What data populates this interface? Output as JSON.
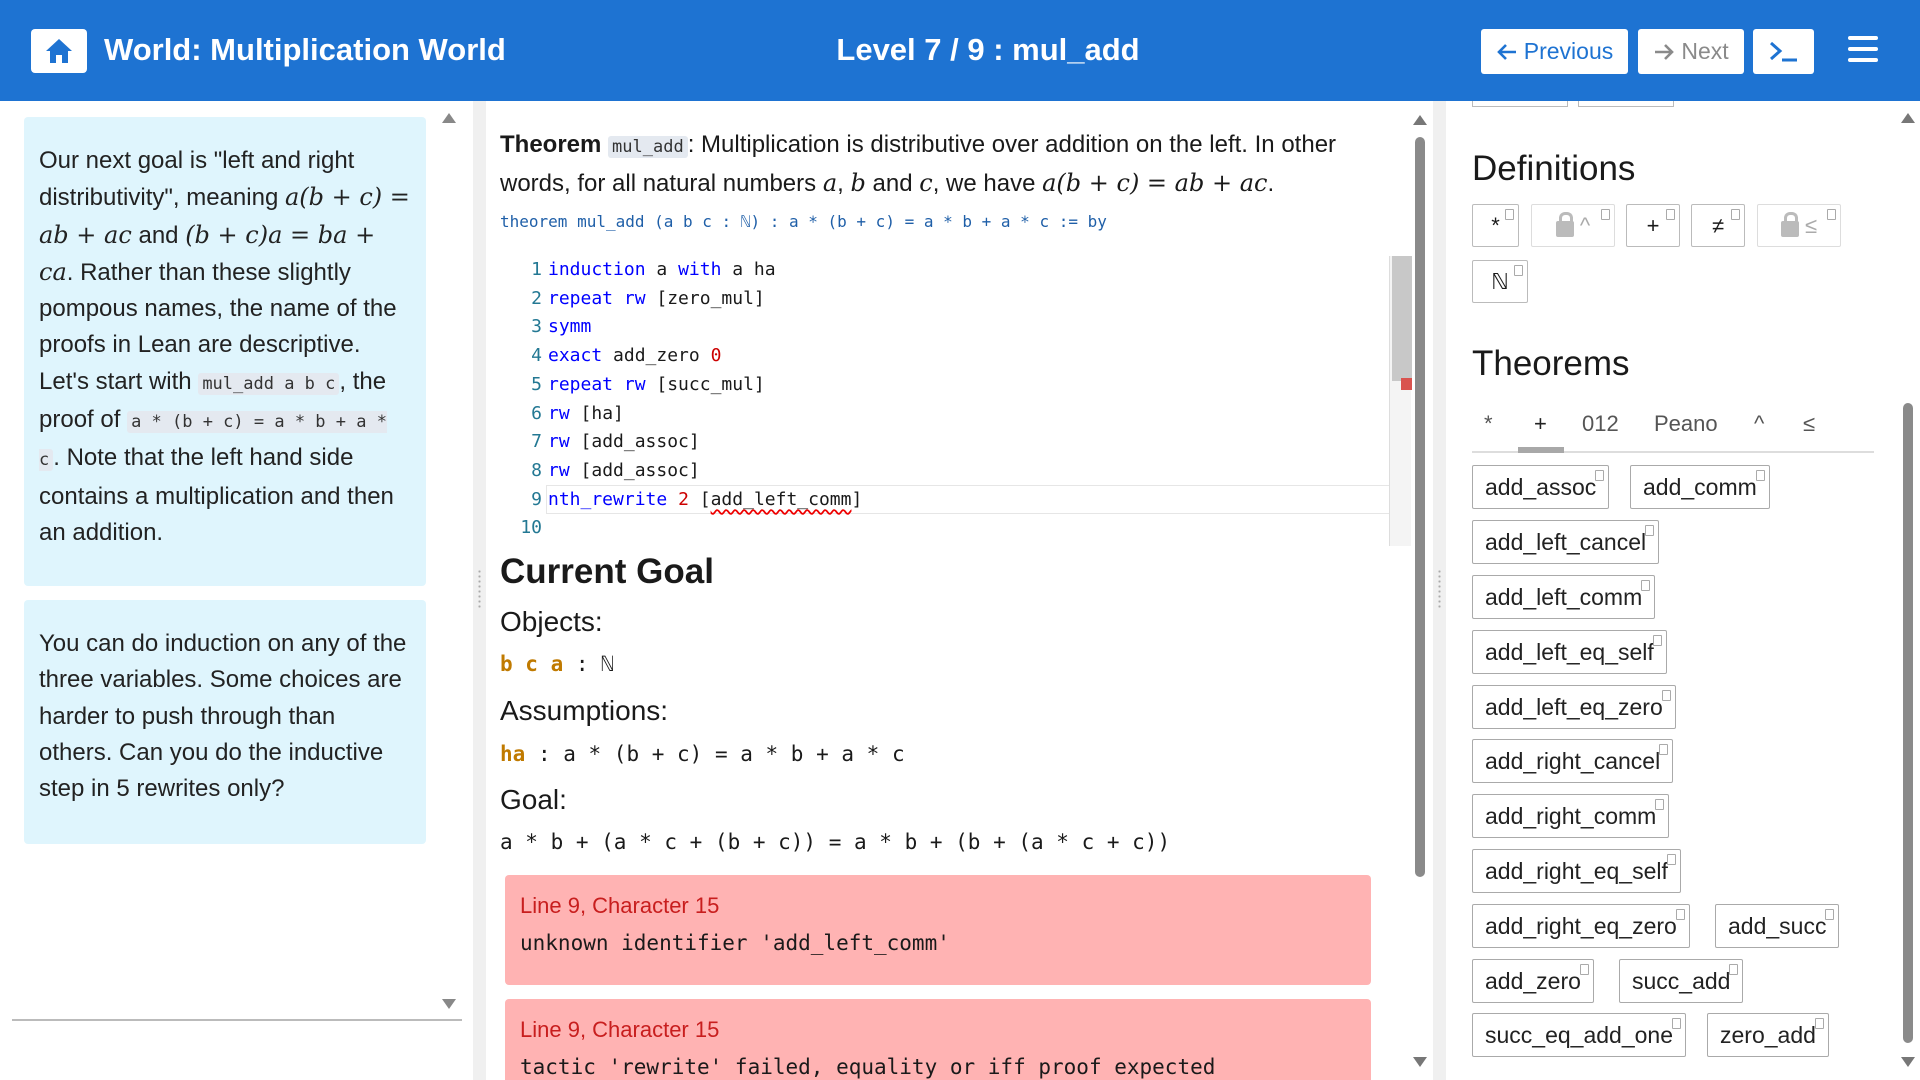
{
  "header": {
    "world_title": "World: Multiplication World",
    "level_title": "Level 7 / 9 : mul_add",
    "previous_label": "Previous",
    "next_label": "Next",
    "bg_color": "#1e73d2"
  },
  "left": {
    "card1": {
      "t1": "Our next goal is \"left and right distributivity\", meaning ",
      "m1": "a(b + c) = ab + ac",
      "t2": " and ",
      "m2": "(b + c)a = ba + ca",
      "t3": ". Rather than these slightly pompous names, the name of the proofs in Lean are descriptive. Let's start with ",
      "c1": "mul_add a b c",
      "t4": ", the proof of ",
      "c2": "a * (b + c) = a * b + a * c",
      "t5": ". Note that the left hand side contains a multiplication and then an addition."
    },
    "card2": "You can do induction on any of the three variables. Some choices are harder to push through than others. Can you do the inductive step in 5 rewrites only?"
  },
  "center": {
    "theorem": {
      "word": "Theorem",
      "name": "mul_add",
      "text1": ": Multiplication is distributive over addition on the left. In other words, for all natural numbers ",
      "ma": "a",
      "sep1": ", ",
      "mb": "b",
      "sep2": " and ",
      "mc": "c",
      "text2": ", we have ",
      "formula": "a(b + c) = ab + ac",
      "end": ".",
      "code": "theorem mul_add (a b c : ℕ) : a * (b + c) = a * b + a * c := by"
    },
    "editor": {
      "lines": [
        {
          "n": "1",
          "kw": "induction",
          "rest": " a ",
          "kw2": "with",
          "rest2": " a ha"
        },
        {
          "n": "2",
          "kw": "repeat rw",
          "rest": " [zero_mul]"
        },
        {
          "n": "3",
          "kw": "symm",
          "rest": ""
        },
        {
          "n": "4",
          "kw": "exact",
          "rest": " add_zero ",
          "num": "0"
        },
        {
          "n": "5",
          "kw": "repeat rw",
          "rest": " [succ_mul]"
        },
        {
          "n": "6",
          "kw": "rw",
          "rest": " [ha]"
        },
        {
          "n": "7",
          "kw": "rw",
          "rest": " [add_assoc]"
        },
        {
          "n": "8",
          "kw": "rw",
          "rest": " [add_assoc]"
        },
        {
          "n": "9",
          "kw": "nth_rewrite",
          "num": "2",
          "rest": " [",
          "err": "add_left_comm",
          "rest2": "]"
        },
        {
          "n": "10"
        }
      ]
    },
    "goal": {
      "heading": "Current Goal",
      "objects_label": "Objects:",
      "objects_names": "b c a",
      "objects_type": "ℕ",
      "assumptions_label": "Assumptions:",
      "hyp_name": "ha",
      "hyp_type": "a * (b + c) = a * b + a * c",
      "goal_label": "Goal:",
      "goal_expr": "a * b + (a * c + (b + c)) = a * b + (b + (a * c + c))"
    },
    "errors": [
      {
        "title": "Line 9, Character 15",
        "msg": "unknown identifier 'add_left_comm'"
      },
      {
        "title": "Line 9, Character 15",
        "msg": "tactic 'rewrite' failed, equality or iff proof expected"
      }
    ]
  },
  "right": {
    "definitions_heading": "Definitions",
    "definitions": [
      "*",
      "^",
      "+",
      "≠",
      "≤",
      "ℕ"
    ],
    "theorems_heading": "Theorems",
    "tabs": [
      "*",
      "+",
      "012",
      "Peano",
      "^",
      "≤"
    ],
    "theorems": [
      "add_assoc",
      "add_comm",
      "add_left_cancel",
      "add_left_comm",
      "add_left_eq_self",
      "add_left_eq_zero",
      "add_right_cancel",
      "add_right_comm",
      "add_right_eq_self",
      "add_right_eq_zero",
      "add_succ",
      "add_zero",
      "succ_add",
      "succ_eq_add_one",
      "zero_add"
    ]
  }
}
